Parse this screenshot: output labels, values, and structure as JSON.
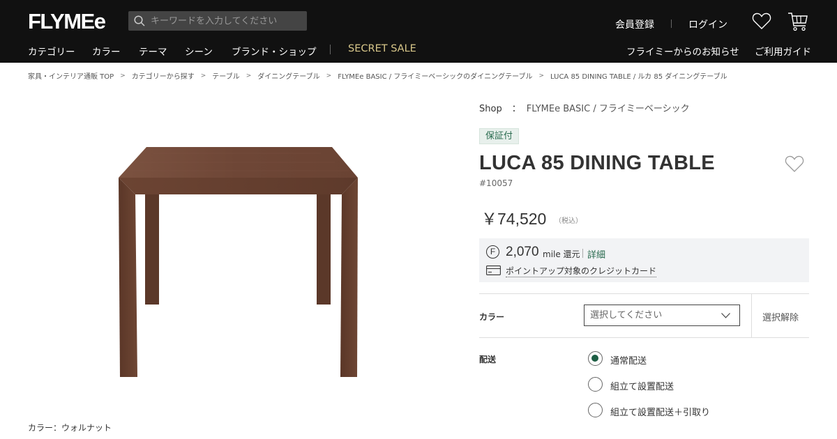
{
  "header": {
    "logo": "FLYMEe",
    "search_placeholder": "キーワードを入力してください",
    "register": "会員登録",
    "login": "ログイン",
    "nav": [
      "カテゴリー",
      "カラー",
      "テーマ",
      "シーン",
      "ブランド・ショップ"
    ],
    "secret_sale": "SECRET SALE",
    "news": "フライミーからのお知らせ",
    "guide": "ご利用ガイド"
  },
  "breadcrumb": [
    "家具・インテリア通販 TOP",
    "カテゴリーから探す",
    "テーブル",
    "ダイニングテーブル",
    "FLYMEe BASIC / フライミーベーシックのダイニングテーブル",
    "LUCA 85 DINING TABLE / ルカ 85 ダイニングテーブル"
  ],
  "breadcrumb_sep": ">",
  "product": {
    "shop_label": "Shop",
    "shop_colon": "：",
    "shop_name": "FLYMEe BASIC / フライミーベーシック",
    "warranty": "保証付",
    "name": "LUCA 85 DINING TABLE",
    "sku": "#10057",
    "price": "￥74,520",
    "tax_note": "（税込）",
    "mile_symbol": "F",
    "mile_amount": "2,070",
    "mile_unit": "mile 還元",
    "mile_detail": "詳細",
    "credit_link": "ポイントアップ対象のクレジットカード",
    "color_caption": "カラー：ウォルナット"
  },
  "options": {
    "color_label": "カラー",
    "color_placeholder": "選択してください",
    "clear": "選択解除",
    "delivery_label": "配送",
    "delivery_options": [
      "通常配送",
      "組立て設置配送",
      "組立て設置配送＋引取り"
    ],
    "delivery_selected": "通常配送"
  },
  "colors": {
    "header_bg": "#111111",
    "secret_sale": "#d8c78a",
    "accent_green": "#1d5e44",
    "wood": "#6b4433"
  }
}
